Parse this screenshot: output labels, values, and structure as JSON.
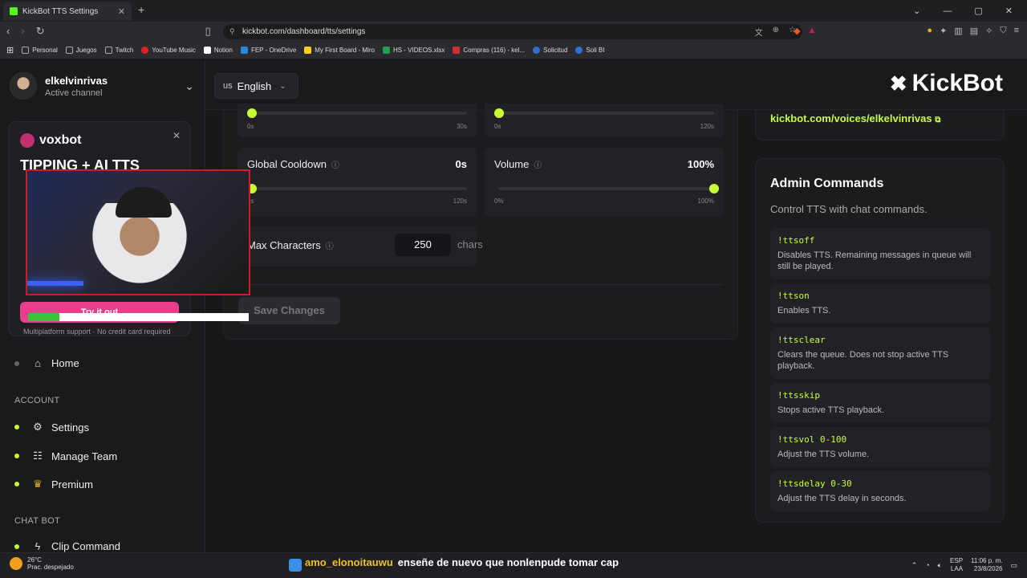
{
  "browser": {
    "tab_title": "KickBot TTS Settings",
    "url": "kickbot.com/dashboard/tts/settings",
    "bookmarks": [
      "Personal",
      "Juegos",
      "Twitch",
      "YouTube Music",
      "Notion",
      "FEP - OneDrive",
      "My First Board - Miro",
      "HS - VIDEOS.xlsx",
      "Compras (116) - kel...",
      "Solicitud",
      "Soli BI"
    ]
  },
  "sidebar": {
    "channel_name": "elkelvinrivas",
    "channel_sub": "Active channel",
    "promo": {
      "logo": "voxbot",
      "headline": "TIPPING + AI TTS",
      "cta": "Try it out",
      "footer": "Multiplatform support · No credit card required"
    },
    "overlay_progress": 0.14,
    "home": "Home",
    "section_account": "ACCOUNT",
    "settings": "Settings",
    "manage_team": "Manage Team",
    "premium": "Premium",
    "section_chatbot": "CHAT BOT",
    "clip_command": "Clip Command"
  },
  "header": {
    "lang_flag": "us",
    "lang_label": "English",
    "brand": "KickBot"
  },
  "settings": {
    "slider_a": {
      "min": "0s",
      "max": "30s",
      "value_fraction": 0
    },
    "slider_b": {
      "min": "0s",
      "max": "120s",
      "value_fraction": 0
    },
    "global_cooldown": {
      "label": "Global Cooldown",
      "value": "0s",
      "min": "0s",
      "max": "120s",
      "value_fraction": 0
    },
    "volume": {
      "label": "Volume",
      "value": "100%",
      "min": "0%",
      "max": "100%",
      "value_fraction": 1
    },
    "max_characters": {
      "label": "Max Characters",
      "value": "250",
      "unit": "chars"
    },
    "save_label": "Save Changes"
  },
  "voices_link": "kickbot.com/voices/elkelvinrivas",
  "admin": {
    "title": "Admin Commands",
    "description": "Control TTS with chat commands.",
    "commands": [
      {
        "name": "!ttsoff",
        "desc": "Disables TTS. Remaining messages in queue will still be played."
      },
      {
        "name": "!ttson",
        "desc": "Enables TTS."
      },
      {
        "name": "!ttsclear",
        "desc": "Clears the queue. Does not stop active TTS playback."
      },
      {
        "name": "!ttsskip",
        "desc": "Stops active TTS playback."
      },
      {
        "name": "!ttsvol 0-100",
        "desc": "Adjust the TTS volume."
      },
      {
        "name": "!ttsdelay 0-30",
        "desc": "Adjust the TTS delay in seconds."
      }
    ]
  },
  "taskbar": {
    "temp": "26°C",
    "weather": "Prac. despejado",
    "caption_user": "amo_elonoitauwu",
    "caption_text": "enseñe de nuevo que nonlenpude tomar cap",
    "lang": "ESP",
    "lang2": "LAA",
    "time": "11:06 p. m.",
    "date": "23/8/2026"
  },
  "colors": {
    "accent": "#c6ff3a",
    "promo_pink": "#e83e8c"
  }
}
